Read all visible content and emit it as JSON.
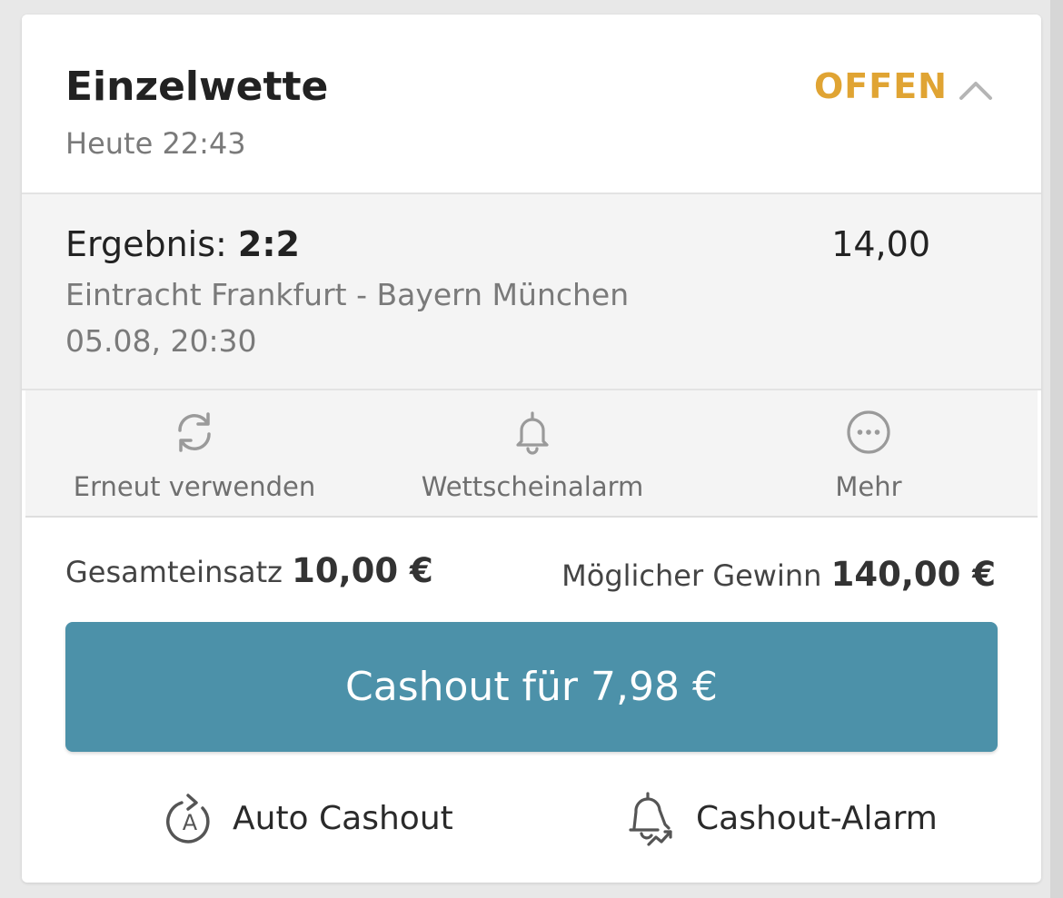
{
  "bet": {
    "type": "Einzelwette",
    "time": "Heute 22:43",
    "status": "OFFEN",
    "status_color": "#e0a433",
    "collapse_icon": "chevron-up-icon"
  },
  "selection": {
    "market_label": "Ergebnis:",
    "market_value": "2:2",
    "odds": "14,00",
    "event": "Eintracht Frankfurt - Bayern München",
    "event_date": "05.08, 20:30"
  },
  "actions": [
    {
      "label": "Erneut verwenden",
      "icon": "refresh-icon"
    },
    {
      "label": "Wettscheinalarm",
      "icon": "bell-icon"
    },
    {
      "label": "Mehr",
      "icon": "more-icon"
    }
  ],
  "totals": {
    "stake_label": "Gesamteinsatz",
    "stake_value": "10,00 €",
    "win_label": "Möglicher Gewinn",
    "win_value": "140,00 €"
  },
  "cashout": {
    "label": "Cashout für 7,98 €",
    "color": "#4c91a9"
  },
  "bottom_links": [
    {
      "label": "Auto Cashout",
      "icon": "auto-cashout-icon"
    },
    {
      "label": "Cashout-Alarm",
      "icon": "cashout-alarm-icon"
    }
  ]
}
